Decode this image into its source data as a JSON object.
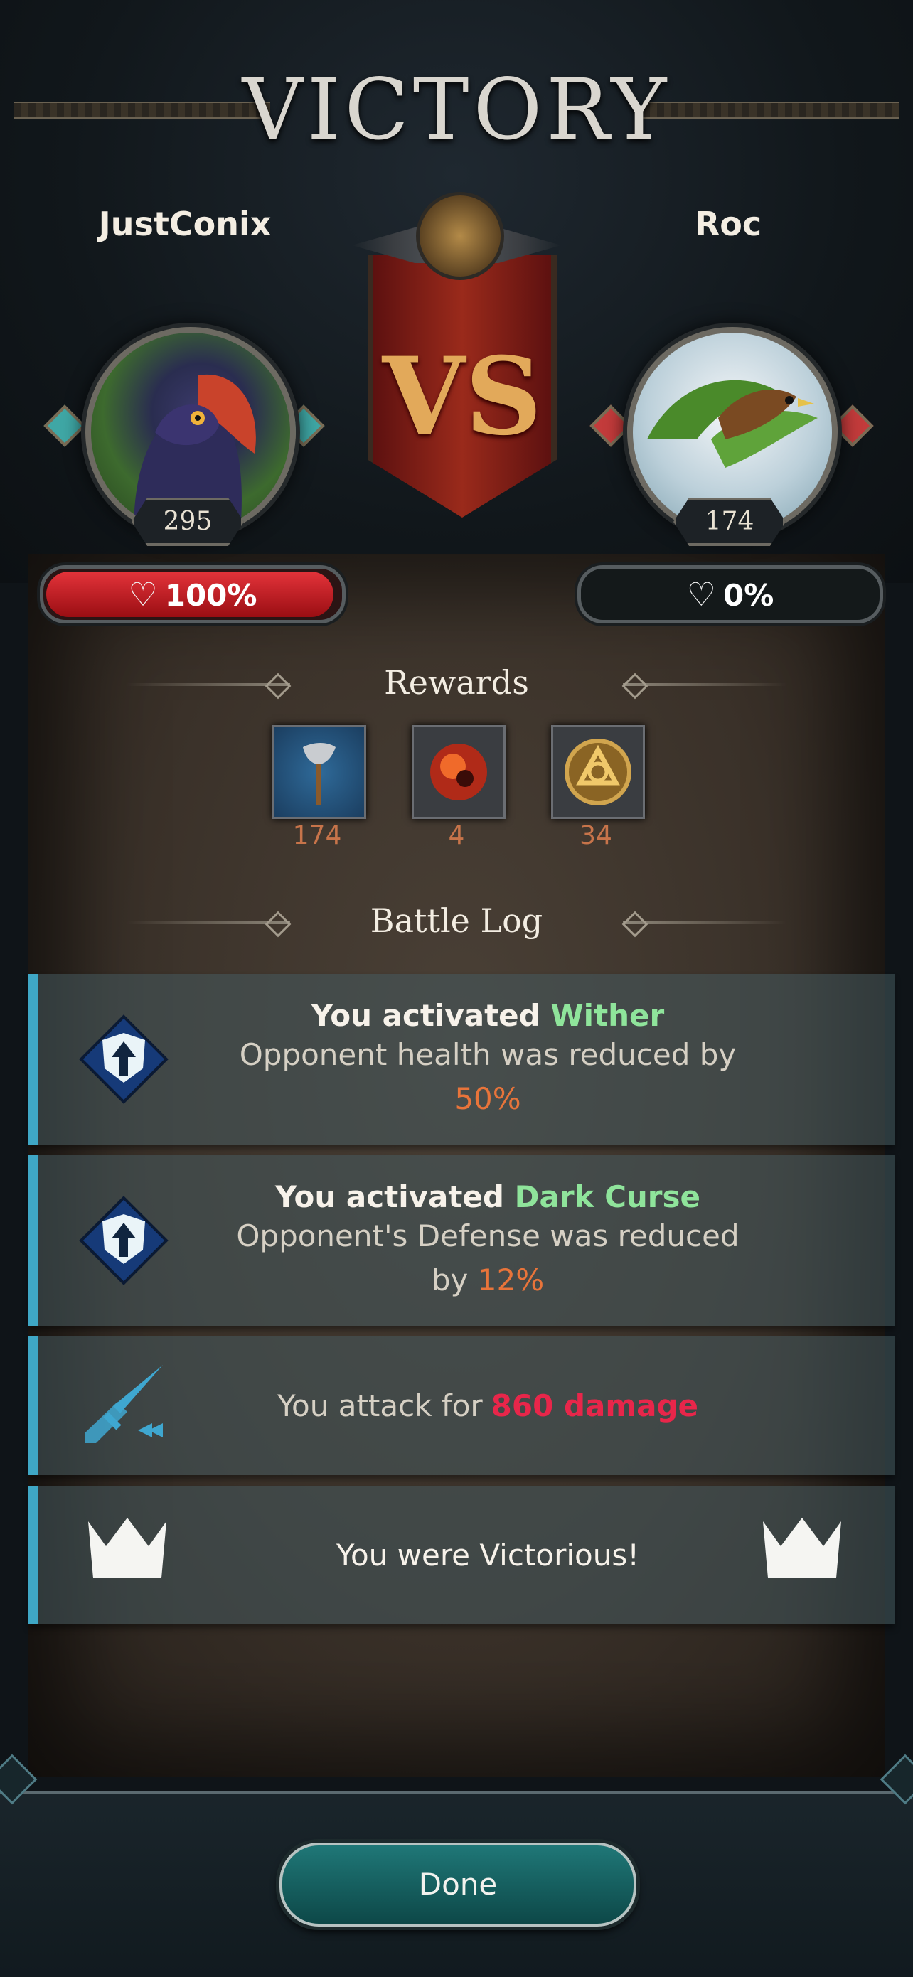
{
  "header": {
    "title": "VICTORY"
  },
  "player": {
    "name": "JustConix",
    "level": "295",
    "health_label": "100%",
    "health_fraction": 1.0
  },
  "opponent": {
    "name": "Roc",
    "level": "174",
    "health_label": "0%",
    "health_fraction": 0.0
  },
  "versus_label": "VS",
  "rewards": {
    "heading": "Rewards",
    "items": [
      {
        "icon": "axe-icon",
        "count": "174"
      },
      {
        "icon": "fire-orb-icon",
        "count": "4"
      },
      {
        "icon": "gold-rune-icon",
        "count": "34"
      }
    ]
  },
  "battle_log": {
    "heading": "Battle Log",
    "entries": [
      {
        "icon": "shield-up-arrow-icon",
        "prefix": "You activated ",
        "ability": "Wither",
        "line2": "Opponent health was reduced by",
        "value": "50%"
      },
      {
        "icon": "shield-up-arrow-icon",
        "prefix": "You activated ",
        "ability": "Dark Curse",
        "line2": "Opponent's Defense was reduced",
        "line3": "by ",
        "value": "12%"
      },
      {
        "icon": "sword-icon",
        "text": "You attack for ",
        "value": "860 damage"
      },
      {
        "icon": "crown-icon",
        "text": "You were Victorious!"
      }
    ]
  },
  "footer": {
    "done_label": "Done"
  },
  "colors": {
    "accent": "#3fa7c5",
    "ability": "#8fe49b",
    "value": "#e8743a",
    "damage": "#e8264a",
    "health_player": "#c8131a"
  }
}
